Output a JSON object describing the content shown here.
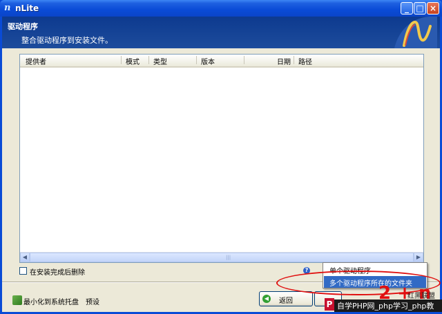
{
  "window": {
    "title": "nLite",
    "logo_glyph": "n"
  },
  "header": {
    "title": "驱动程序",
    "subtitle": "整合驱动程序到安装文件。"
  },
  "list": {
    "columns": [
      "提供者",
      "模式",
      "类型",
      "版本",
      "日期",
      "路径"
    ],
    "rows": []
  },
  "options": {
    "delete_after_install_label": "在安装完成后删除",
    "delete_after_install_checked": false
  },
  "footer": {
    "minimize_tray_label": "最小化到系统托盘",
    "preset_label": "预设",
    "back_button_label": "返回",
    "next_button_label": ""
  },
  "menu": {
    "items": [
      "单个驱动程序",
      "多个驱动程序所在的文件夹"
    ],
    "highlighted_index": 1
  },
  "watermark": {
    "text": "自学PHP网_php学习_php教",
    "brand": "红黑联盟",
    "red_mark": "2 + n"
  },
  "colors": {
    "titlebar": "#0a4bd6",
    "header": "#1d4c9c",
    "panel": "#ece9d8",
    "menu_highlight": "#316ac5",
    "annotation": "#e01010"
  }
}
